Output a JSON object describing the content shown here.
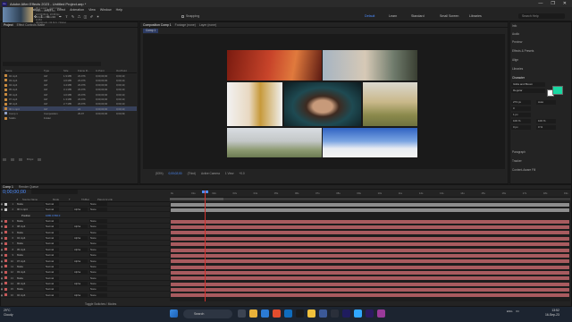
{
  "window": {
    "title": "Adobe After Effects 2023 - Untitled Project.aep *",
    "app_badge": "Ae",
    "controls": [
      "—",
      "❐",
      "✕"
    ]
  },
  "menu": [
    "File",
    "Edit",
    "Composition",
    "Layer",
    "Effect",
    "Animation",
    "View",
    "Window",
    "Help"
  ],
  "toolbar": {
    "snapping_label": "Snapping",
    "workspaces": [
      "Default",
      "Learn",
      "Standard",
      "Small Screen",
      "Libraries"
    ],
    "active_workspace": "Default",
    "search_placeholder": "Search Help"
  },
  "project_panel": {
    "tab": "Project",
    "effect_controls_tab": "Effect Controls Matte",
    "info": [
      "00 1.mp4 ▾ , used 1 time",
      "1920 x 1080 (1.00)",
      "Δ 0;00;09;11, 23.98 fps",
      "Millions of Colors",
      "H.264",
      "48.000 kHz / 32 bit U / Stereo"
    ],
    "headers": [
      "Name",
      "",
      "Type",
      "Size",
      "Frame R...",
      "In Point",
      "Out Point"
    ],
    "items": [
      {
        "name": "02.mp4",
        "type": "AVI",
        "size": "1.9 MB",
        "fps": "23.976",
        "in": "0;00;00;00",
        "out": "0;00;10;",
        "selected": false
      },
      {
        "name": "03.mp4",
        "type": "AVI",
        "size": "4.6 MB",
        "fps": "23.976",
        "in": "0;00;00;00",
        "out": "0;00;10;",
        "selected": false
      },
      {
        "name": "04.mp4",
        "type": "AVI",
        "size": "4.4 MB",
        "fps": "23.976",
        "in": "0;00;00;00",
        "out": "0;00;10;",
        "selected": false
      },
      {
        "name": "05.mp4",
        "type": "AVI",
        "size": "3.1 MB",
        "fps": "23.976",
        "in": "0;00;00;00",
        "out": "0;00;10;",
        "selected": false
      },
      {
        "name": "06.mp4",
        "type": "AVI",
        "size": "4.0 MB",
        "fps": "23.976",
        "in": "0;00;00;00",
        "out": "0;00;10;",
        "selected": false
      },
      {
        "name": "07.mp4",
        "type": "AVI",
        "size": "1.3 MB",
        "fps": "23.976",
        "in": "0;00;00;00",
        "out": "0;00;10;",
        "selected": false
      },
      {
        "name": "08.mp4",
        "type": "AVI",
        "size": "2.7 MB",
        "fps": "23.976",
        "in": "0;00;00;00",
        "out": "0;00;10;",
        "selected": false
      },
      {
        "name": "00 1.mp4",
        "type": "AVI",
        "size": "...",
        "fps": "24",
        "in": "0;00;00;00",
        "out": "0;00;10;",
        "selected": true
      },
      {
        "name": "Comp 1",
        "type": "Composition",
        "size": "",
        "fps": "29.97",
        "in": "0;00;00;00",
        "out": "0;00;09;",
        "selected": false
      },
      {
        "name": "Solids",
        "type": "Folder",
        "size": "",
        "fps": "",
        "in": "",
        "out": "",
        "selected": false
      }
    ],
    "bpc": "8 bpc"
  },
  "viewer": {
    "tabs": [
      "Composition Comp 1",
      "Footage (none)",
      "Layer (none)"
    ],
    "sub_tab": "Comp 1",
    "zoom": "(53%)",
    "timecode": "0;00;02;00",
    "quality": "(Third)",
    "camera": "Active Camera",
    "views": "1 View",
    "exposure": "+0.0"
  },
  "right_panel": {
    "items": [
      "Info",
      "Audio",
      "Preview",
      "Effects & Presets",
      "Align",
      "Libraries"
    ],
    "character_heading": "Character",
    "font": "Gilda and Bloom",
    "style": "Regular",
    "size": "273 px",
    "leading": "Auto",
    "tracking": "0",
    "stroke": "1 px",
    "scale_v": "100 %",
    "scale_h": "100 %",
    "baseline": "0 px",
    "tsume": "0 %",
    "more_items": [
      "Paragraph",
      "Tracker",
      "Content-Aware Fill"
    ],
    "fill_color": "#19d8a2",
    "stroke_color": "#ffffff"
  },
  "timeline": {
    "tabs": [
      "Comp 1",
      "Render Queue"
    ],
    "timecode": "0;00;00;00",
    "headers": [
      "#",
      "Source Name",
      "Mode",
      "T",
      "TrkMat",
      "Parent & Link"
    ],
    "layers": [
      {
        "num": "1",
        "name": "Matte",
        "mode": "Normal",
        "trkmat": "",
        "parent": "None",
        "label": "#c4c4c4",
        "bar": "#8e8e8e"
      },
      {
        "num": "2",
        "name": "00 1.mp4",
        "mode": "Normal",
        "trkmat": "Alpha",
        "parent": "None",
        "label": "#c4c4c4",
        "bar": "#8e8e8e"
      },
      {
        "num": "",
        "name": "Position",
        "mode": "1080.0,560.0",
        "trkmat": "",
        "parent": "",
        "label": "",
        "bar": ""
      },
      {
        "num": "3",
        "name": "Matte",
        "mode": "Normal",
        "trkmat": "",
        "parent": "None",
        "label": "#c75a5a",
        "bar": "#a85b5f"
      },
      {
        "num": "4",
        "name": "08.mp4",
        "mode": "Normal",
        "trkmat": "Alpha",
        "parent": "None",
        "label": "#c75a5a",
        "bar": "#a85b5f"
      },
      {
        "num": "5",
        "name": "Matte",
        "mode": "Normal",
        "trkmat": "",
        "parent": "None",
        "label": "#c75a5a",
        "bar": "#a85b5f"
      },
      {
        "num": "6",
        "name": "04.mp4",
        "mode": "Normal",
        "trkmat": "Alpha",
        "parent": "None",
        "label": "#c75a5a",
        "bar": "#a85b5f"
      },
      {
        "num": "7",
        "name": "Matte",
        "mode": "Normal",
        "trkmat": "",
        "parent": "None",
        "label": "#c75a5a",
        "bar": "#a85b5f"
      },
      {
        "num": "8",
        "name": "05.mp4",
        "mode": "Normal",
        "trkmat": "Alpha",
        "parent": "None",
        "label": "#c75a5a",
        "bar": "#a85b5f"
      },
      {
        "num": "9",
        "name": "Matte",
        "mode": "Normal",
        "trkmat": "",
        "parent": "None",
        "label": "#c75a5a",
        "bar": "#a85b5f"
      },
      {
        "num": "10",
        "name": "07.mp4",
        "mode": "Normal",
        "trkmat": "Alpha",
        "parent": "None",
        "label": "#c75a5a",
        "bar": "#a85b5f"
      },
      {
        "num": "11",
        "name": "Matte",
        "mode": "Normal",
        "trkmat": "",
        "parent": "None",
        "label": "#c75a5a",
        "bar": "#a85b5f"
      },
      {
        "num": "12",
        "name": "03.mp4",
        "mode": "Normal",
        "trkmat": "Alpha",
        "parent": "None",
        "label": "#c75a5a",
        "bar": "#a85b5f"
      },
      {
        "num": "13",
        "name": "Matte",
        "mode": "Normal",
        "trkmat": "",
        "parent": "None",
        "label": "#c75a5a",
        "bar": "#a85b5f"
      },
      {
        "num": "14",
        "name": "06.mp4",
        "mode": "Normal",
        "trkmat": "Alpha",
        "parent": "None",
        "label": "#c75a5a",
        "bar": "#a85b5f"
      },
      {
        "num": "15",
        "name": "Matte",
        "mode": "Normal",
        "trkmat": "",
        "parent": "None",
        "label": "#c75a5a",
        "bar": "#a85b5f"
      },
      {
        "num": "16",
        "name": "02.mp4",
        "mode": "Normal",
        "trkmat": "Alpha",
        "parent": "None",
        "label": "#c75a5a",
        "bar": "#a85b5f"
      }
    ],
    "ruler_ticks": [
      "0s",
      "01s",
      "02s",
      "03s",
      "04s",
      "05s",
      "06s",
      "07s",
      "08s",
      "09s",
      "10s",
      "11s",
      "12s",
      "13s",
      "14s",
      "15s",
      "16s",
      "17s",
      "18s",
      "19s"
    ],
    "playhead_seconds": 2,
    "bottom_label": "Toggle Switches / Modes"
  },
  "taskbar": {
    "weather_temp": "29°C",
    "weather_desc": "Cloudy",
    "search_placeholder": "Search",
    "tray": [
      "ENG",
      "IN"
    ],
    "time": "13:52",
    "date": "16-Sep-23"
  }
}
